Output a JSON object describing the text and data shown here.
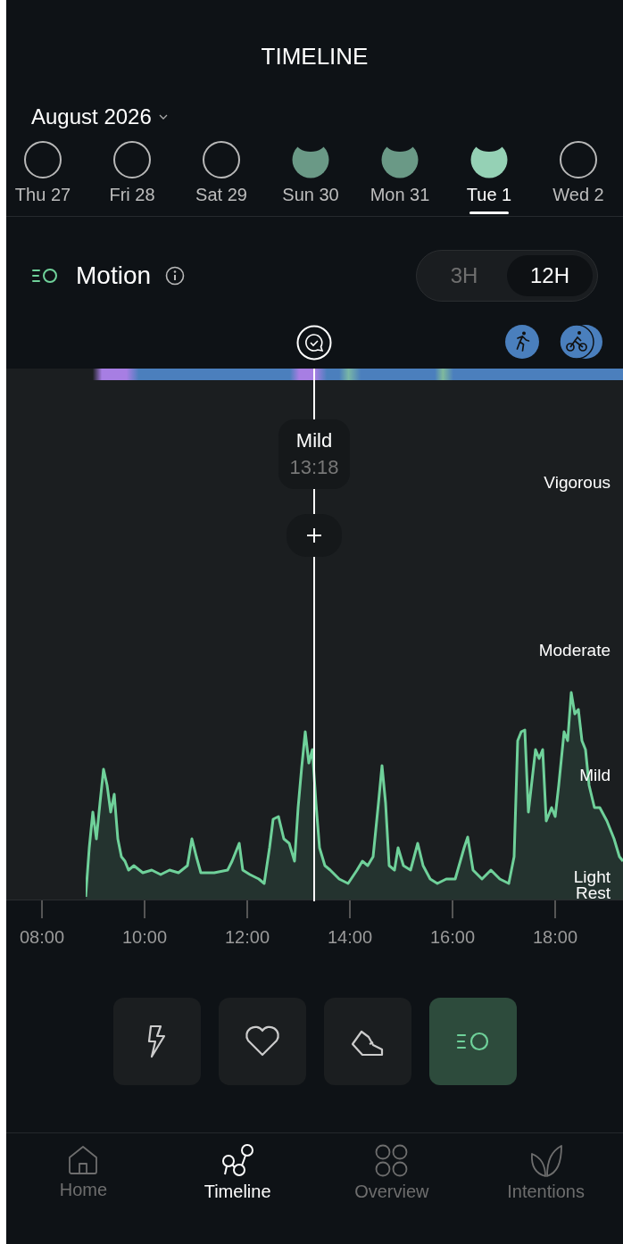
{
  "header": {
    "title": "TIMELINE",
    "month": "August 2026"
  },
  "days": [
    {
      "label": "Thu 27",
      "filled": false,
      "selected": false
    },
    {
      "label": "Fri 28",
      "filled": false,
      "selected": false
    },
    {
      "label": "Sat 29",
      "filled": false,
      "selected": false
    },
    {
      "label": "Sun 30",
      "filled": true,
      "selected": false
    },
    {
      "label": "Mon 31",
      "filled": true,
      "selected": false
    },
    {
      "label": "Tue 1",
      "filled": true,
      "selected": true
    },
    {
      "label": "Wed 2",
      "filled": false,
      "selected": false
    }
  ],
  "section": {
    "title": "Motion",
    "ranges": [
      {
        "label": "3H",
        "selected": false
      },
      {
        "label": "12H",
        "selected": true
      }
    ]
  },
  "chart": {
    "level_labels": [
      "Vigorous",
      "Moderate",
      "Mild",
      "Light",
      "Rest"
    ],
    "time_labels": [
      "08:00",
      "10:00",
      "12:00",
      "14:00",
      "16:00",
      "18:00"
    ],
    "tooltip": {
      "level": "Mild",
      "time": "13:18"
    }
  },
  "metrics": [
    {
      "kind": "energy",
      "selected": false
    },
    {
      "kind": "heart",
      "selected": false
    },
    {
      "kind": "shoe",
      "selected": false
    },
    {
      "kind": "motion",
      "selected": true
    }
  ],
  "nav": [
    {
      "kind": "home",
      "label": "Home",
      "selected": false
    },
    {
      "kind": "timeline",
      "label": "Timeline",
      "selected": true
    },
    {
      "kind": "overview",
      "label": "Overview",
      "selected": false
    },
    {
      "kind": "intentions",
      "label": "Intentions",
      "selected": false
    }
  ]
}
